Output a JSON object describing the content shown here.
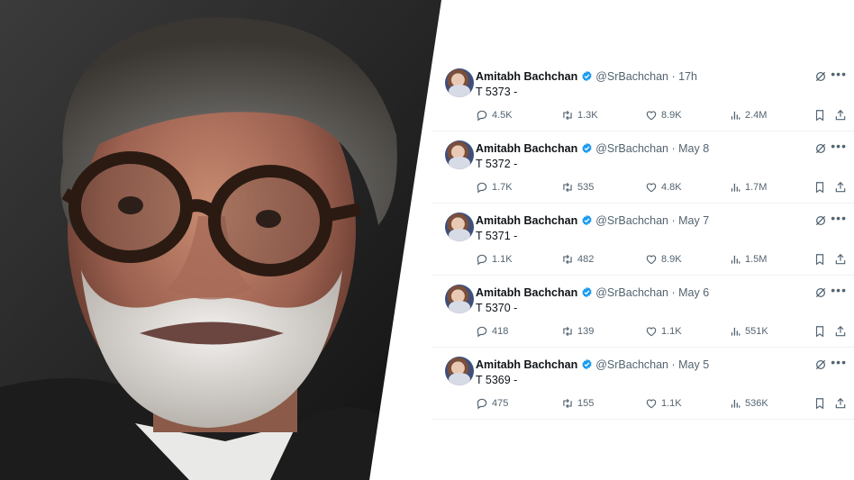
{
  "tweets": [
    {
      "name": "Amitabh Bachchan",
      "handle": "@SrBachchan",
      "time": "17h",
      "text": "T 5373 -",
      "replies": "4.5K",
      "retweets": "1.3K",
      "likes": "8.9K",
      "views": "2.4M"
    },
    {
      "name": "Amitabh Bachchan",
      "handle": "@SrBachchan",
      "time": "May 8",
      "text": "T 5372 -",
      "replies": "1.7K",
      "retweets": "535",
      "likes": "4.8K",
      "views": "1.7M"
    },
    {
      "name": "Amitabh Bachchan",
      "handle": "@SrBachchan",
      "time": "May 7",
      "text": "T 5371 -",
      "replies": "1.1K",
      "retweets": "482",
      "likes": "8.9K",
      "views": "1.5M"
    },
    {
      "name": "Amitabh Bachchan",
      "handle": "@SrBachchan",
      "time": "May 6",
      "text": "T 5370 -",
      "replies": "418",
      "retweets": "139",
      "likes": "1.1K",
      "views": "551K"
    },
    {
      "name": "Amitabh Bachchan",
      "handle": "@SrBachchan",
      "time": "May 5",
      "text": "T 5369 -",
      "replies": "475",
      "retweets": "155",
      "likes": "1.1K",
      "views": "536K"
    }
  ],
  "icons": {
    "verified": "verified-badge-icon",
    "reply": "reply-icon",
    "retweet": "retweet-icon",
    "like": "heart-icon",
    "views": "views-bar-chart-icon",
    "bookmark": "bookmark-icon",
    "share": "share-icon",
    "grok": "grok-icon",
    "more": "more-options-icon"
  },
  "colors": {
    "verified": "#1d9bf0",
    "secondary_text": "#536471",
    "primary_text": "#0f1419"
  }
}
